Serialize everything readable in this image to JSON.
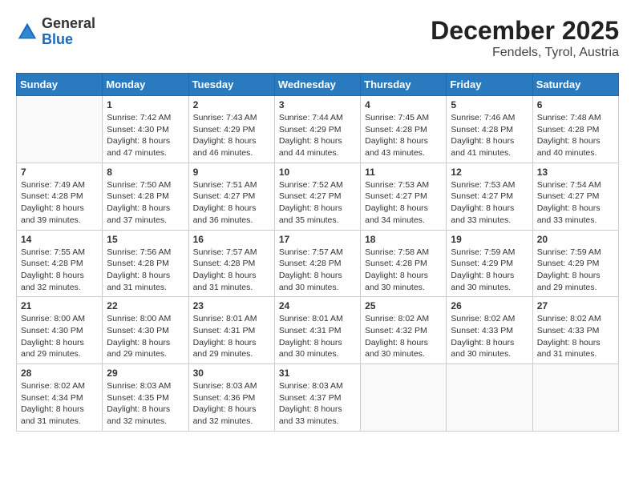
{
  "header": {
    "logo_general": "General",
    "logo_blue": "Blue",
    "month_year": "December 2025",
    "location": "Fendels, Tyrol, Austria"
  },
  "weekdays": [
    "Sunday",
    "Monday",
    "Tuesday",
    "Wednesday",
    "Thursday",
    "Friday",
    "Saturday"
  ],
  "weeks": [
    [
      {
        "day": "",
        "info": ""
      },
      {
        "day": "1",
        "info": "Sunrise: 7:42 AM\nSunset: 4:30 PM\nDaylight: 8 hours\nand 47 minutes."
      },
      {
        "day": "2",
        "info": "Sunrise: 7:43 AM\nSunset: 4:29 PM\nDaylight: 8 hours\nand 46 minutes."
      },
      {
        "day": "3",
        "info": "Sunrise: 7:44 AM\nSunset: 4:29 PM\nDaylight: 8 hours\nand 44 minutes."
      },
      {
        "day": "4",
        "info": "Sunrise: 7:45 AM\nSunset: 4:28 PM\nDaylight: 8 hours\nand 43 minutes."
      },
      {
        "day": "5",
        "info": "Sunrise: 7:46 AM\nSunset: 4:28 PM\nDaylight: 8 hours\nand 41 minutes."
      },
      {
        "day": "6",
        "info": "Sunrise: 7:48 AM\nSunset: 4:28 PM\nDaylight: 8 hours\nand 40 minutes."
      }
    ],
    [
      {
        "day": "7",
        "info": "Sunrise: 7:49 AM\nSunset: 4:28 PM\nDaylight: 8 hours\nand 39 minutes."
      },
      {
        "day": "8",
        "info": "Sunrise: 7:50 AM\nSunset: 4:28 PM\nDaylight: 8 hours\nand 37 minutes."
      },
      {
        "day": "9",
        "info": "Sunrise: 7:51 AM\nSunset: 4:27 PM\nDaylight: 8 hours\nand 36 minutes."
      },
      {
        "day": "10",
        "info": "Sunrise: 7:52 AM\nSunset: 4:27 PM\nDaylight: 8 hours\nand 35 minutes."
      },
      {
        "day": "11",
        "info": "Sunrise: 7:53 AM\nSunset: 4:27 PM\nDaylight: 8 hours\nand 34 minutes."
      },
      {
        "day": "12",
        "info": "Sunrise: 7:53 AM\nSunset: 4:27 PM\nDaylight: 8 hours\nand 33 minutes."
      },
      {
        "day": "13",
        "info": "Sunrise: 7:54 AM\nSunset: 4:27 PM\nDaylight: 8 hours\nand 33 minutes."
      }
    ],
    [
      {
        "day": "14",
        "info": "Sunrise: 7:55 AM\nSunset: 4:28 PM\nDaylight: 8 hours\nand 32 minutes."
      },
      {
        "day": "15",
        "info": "Sunrise: 7:56 AM\nSunset: 4:28 PM\nDaylight: 8 hours\nand 31 minutes."
      },
      {
        "day": "16",
        "info": "Sunrise: 7:57 AM\nSunset: 4:28 PM\nDaylight: 8 hours\nand 31 minutes."
      },
      {
        "day": "17",
        "info": "Sunrise: 7:57 AM\nSunset: 4:28 PM\nDaylight: 8 hours\nand 30 minutes."
      },
      {
        "day": "18",
        "info": "Sunrise: 7:58 AM\nSunset: 4:28 PM\nDaylight: 8 hours\nand 30 minutes."
      },
      {
        "day": "19",
        "info": "Sunrise: 7:59 AM\nSunset: 4:29 PM\nDaylight: 8 hours\nand 30 minutes."
      },
      {
        "day": "20",
        "info": "Sunrise: 7:59 AM\nSunset: 4:29 PM\nDaylight: 8 hours\nand 29 minutes."
      }
    ],
    [
      {
        "day": "21",
        "info": "Sunrise: 8:00 AM\nSunset: 4:30 PM\nDaylight: 8 hours\nand 29 minutes."
      },
      {
        "day": "22",
        "info": "Sunrise: 8:00 AM\nSunset: 4:30 PM\nDaylight: 8 hours\nand 29 minutes."
      },
      {
        "day": "23",
        "info": "Sunrise: 8:01 AM\nSunset: 4:31 PM\nDaylight: 8 hours\nand 29 minutes."
      },
      {
        "day": "24",
        "info": "Sunrise: 8:01 AM\nSunset: 4:31 PM\nDaylight: 8 hours\nand 30 minutes."
      },
      {
        "day": "25",
        "info": "Sunrise: 8:02 AM\nSunset: 4:32 PM\nDaylight: 8 hours\nand 30 minutes."
      },
      {
        "day": "26",
        "info": "Sunrise: 8:02 AM\nSunset: 4:33 PM\nDaylight: 8 hours\nand 30 minutes."
      },
      {
        "day": "27",
        "info": "Sunrise: 8:02 AM\nSunset: 4:33 PM\nDaylight: 8 hours\nand 31 minutes."
      }
    ],
    [
      {
        "day": "28",
        "info": "Sunrise: 8:02 AM\nSunset: 4:34 PM\nDaylight: 8 hours\nand 31 minutes."
      },
      {
        "day": "29",
        "info": "Sunrise: 8:03 AM\nSunset: 4:35 PM\nDaylight: 8 hours\nand 32 minutes."
      },
      {
        "day": "30",
        "info": "Sunrise: 8:03 AM\nSunset: 4:36 PM\nDaylight: 8 hours\nand 32 minutes."
      },
      {
        "day": "31",
        "info": "Sunrise: 8:03 AM\nSunset: 4:37 PM\nDaylight: 8 hours\nand 33 minutes."
      },
      {
        "day": "",
        "info": ""
      },
      {
        "day": "",
        "info": ""
      },
      {
        "day": "",
        "info": ""
      }
    ]
  ]
}
